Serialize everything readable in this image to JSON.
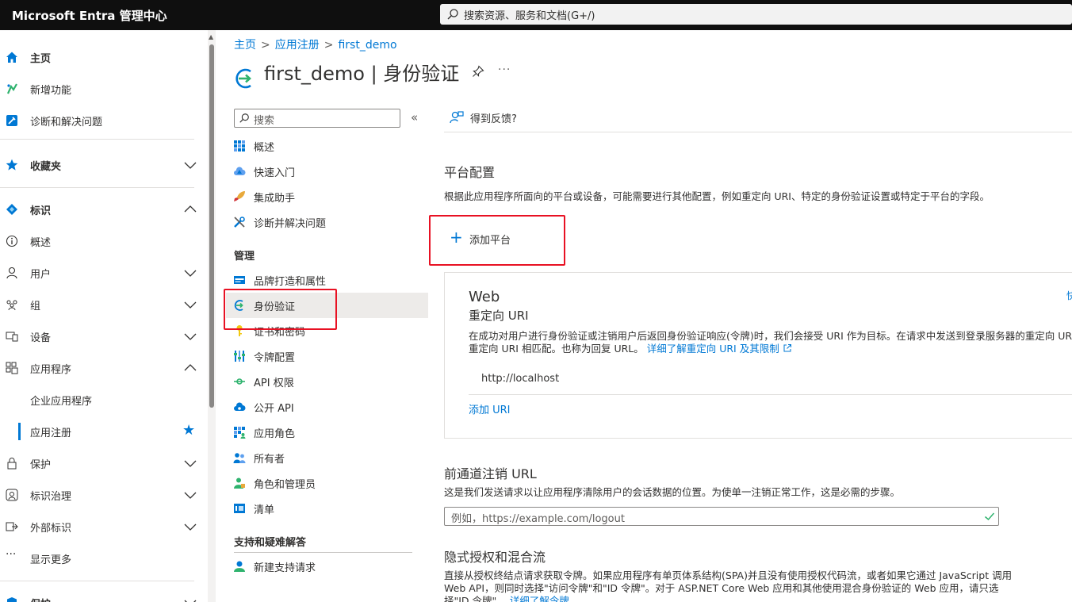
{
  "app": {
    "title": "Microsoft Entra 管理中心"
  },
  "global_search": {
    "placeholder": "搜索资源、服务和文档(G+/)"
  },
  "leftnav": {
    "home": "主页",
    "whats_new": "新增功能",
    "diagnose": "诊断和解决问题",
    "favorites": "收藏夹",
    "identity": "标识",
    "overview": "概述",
    "users": "用户",
    "groups": "组",
    "devices": "设备",
    "applications": "应用程序",
    "enterprise_apps": "企业应用程序",
    "app_registrations": "应用注册",
    "protection": "保护",
    "identity_governance": "标识治理",
    "external_identities": "外部标识",
    "show_more": "显示更多",
    "protection2": "保护"
  },
  "breadcrumb": [
    "主页",
    "应用注册",
    "first_demo"
  ],
  "page": {
    "title": "first_demo | 身份验证",
    "more": "···"
  },
  "resource_menu": {
    "search_placeholder": "搜索",
    "collapse": "«",
    "items_top": [
      {
        "label": "概述",
        "icon": "grid-icon"
      },
      {
        "label": "快速入门",
        "icon": "cloud-icon"
      },
      {
        "label": "集成助手",
        "icon": "rocket-icon"
      },
      {
        "label": "诊断并解决问题",
        "icon": "wrench-icon"
      }
    ],
    "section_manage": "管理",
    "items_manage": [
      {
        "label": "品牌打造和属性",
        "icon": "branding-icon"
      },
      {
        "label": "身份验证",
        "icon": "authentication-icon"
      },
      {
        "label": "证书和密码",
        "icon": "key-icon"
      },
      {
        "label": "令牌配置",
        "icon": "token-icon"
      },
      {
        "label": "API 权限",
        "icon": "api-permissions-icon"
      },
      {
        "label": "公开 API",
        "icon": "cloud-api-icon"
      },
      {
        "label": "应用角色",
        "icon": "app-roles-icon"
      },
      {
        "label": "所有者",
        "icon": "owners-icon"
      },
      {
        "label": "角色和管理员",
        "icon": "roles-admin-icon"
      },
      {
        "label": "清单",
        "icon": "manifest-icon"
      }
    ],
    "section_support": "支持和疑难解答",
    "items_support": [
      {
        "label": "新建支持请求",
        "icon": "support-icon"
      }
    ]
  },
  "main": {
    "feedback": "得到反馈?",
    "platform_heading": "平台配置",
    "platform_desc": "根据此应用程序所面向的平台或设备，可能需要进行其他配置，例如重定向 URI、特定的身份验证设置或特定于平台的字段。",
    "add_platform": "添加平台",
    "web_card": {
      "title": "Web",
      "subtitle": "重定向 URI",
      "desc_line1": "在成功对用户进行身份验证或注销用户后返回身份验证响应(令牌)时，我们会接受 URI 作为目标。在请求中发送到登录服务器的重定向 URI 必须与此处列出的重定向",
      "desc_line2": "重定向 URI 相匹配。也称为回复 URL。",
      "learn_more": "详细了解重定向 URI 及其限制",
      "uri": "http://localhost",
      "add_uri": "添加 URI",
      "edge_text": "快"
    },
    "logout_heading": "前通道注销 URL",
    "logout_desc": "这是我们发送请求以让应用程序清除用户的会话数据的位置。为使单一注销正常工作，这是必需的步骤。",
    "logout_placeholder": "例如，https://example.com/logout",
    "implicit_heading": "隐式授权和混合流",
    "implicit_desc": "直接从授权终结点请求获取令牌。如果应用程序有单页体系结构(SPA)并且没有使用授权代码流，或者如果它通过 JavaScript 调用 Web API，则同时选择\"访问令牌\"和\"ID 令牌\"。对于 ASP.NET Core Web 应用和其他使用混合身份验证的 Web 应用，请只选择\"ID 令牌\"。",
    "implicit_learn_more": "详细了解令牌"
  },
  "colors": {
    "accent": "#0078d4",
    "topbar": "#0f0f0f",
    "annotation": "#e81123"
  }
}
